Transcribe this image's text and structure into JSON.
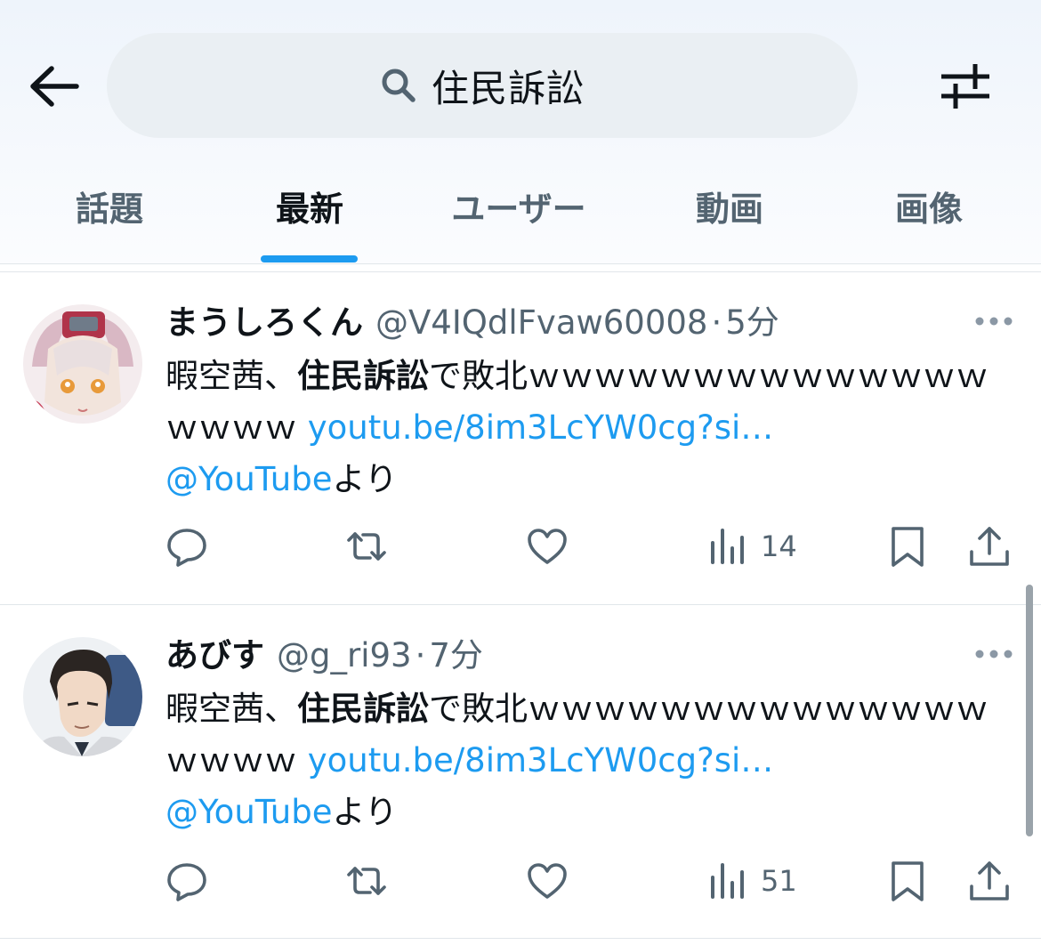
{
  "search": {
    "query": "住民訴訟"
  },
  "tabs": [
    {
      "label": "話題",
      "active": false
    },
    {
      "label": "最新",
      "active": true
    },
    {
      "label": "ユーザー",
      "active": false
    },
    {
      "label": "動画",
      "active": false
    },
    {
      "label": "画像",
      "active": false
    }
  ],
  "colors": {
    "accent": "#1d9bf0",
    "secondary_text": "#536471"
  },
  "posts": [
    {
      "name": "まうしろくん",
      "handle": "@V4IQdlFvaw60008",
      "sep": "·",
      "time": "5分",
      "text_pre": "暇空茜、",
      "text_bold": "住民訴訟",
      "text_post": "で敗北ｗｗｗｗｗｗｗｗｗｗｗｗｗｗｗｗｗｗ",
      "link": "youtu.be/8im3LcYW0cg?si…",
      "mention": "@YouTube",
      "mention_suffix": "より",
      "views": "14",
      "avatar_icon": "anime-girl-avatar"
    },
    {
      "name": "あびす",
      "handle": "@g_ri93",
      "sep": "·",
      "time": "7分",
      "text_pre": "暇空茜、",
      "text_bold": "住民訴訟",
      "text_post": "で敗北ｗｗｗｗｗｗｗｗｗｗｗｗｗｗｗｗｗｗ",
      "link": "youtu.be/8im3LcYW0cg?si…",
      "mention": "@YouTube",
      "mention_suffix": "より",
      "views": "51",
      "avatar_icon": "anime-man-avatar"
    }
  ]
}
